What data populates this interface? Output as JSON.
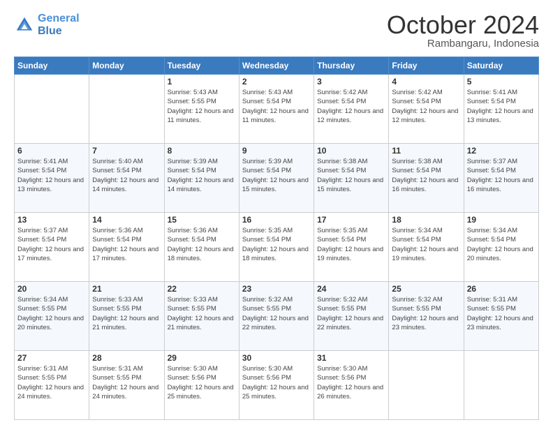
{
  "logo": {
    "line1": "General",
    "line2": "Blue"
  },
  "header": {
    "month": "October 2024",
    "location": "Rambangaru, Indonesia"
  },
  "weekdays": [
    "Sunday",
    "Monday",
    "Tuesday",
    "Wednesday",
    "Thursday",
    "Friday",
    "Saturday"
  ],
  "weeks": [
    [
      {
        "day": "",
        "sunrise": "",
        "sunset": "",
        "daylight": ""
      },
      {
        "day": "",
        "sunrise": "",
        "sunset": "",
        "daylight": ""
      },
      {
        "day": "1",
        "sunrise": "Sunrise: 5:43 AM",
        "sunset": "Sunset: 5:55 PM",
        "daylight": "Daylight: 12 hours and 11 minutes."
      },
      {
        "day": "2",
        "sunrise": "Sunrise: 5:43 AM",
        "sunset": "Sunset: 5:54 PM",
        "daylight": "Daylight: 12 hours and 11 minutes."
      },
      {
        "day": "3",
        "sunrise": "Sunrise: 5:42 AM",
        "sunset": "Sunset: 5:54 PM",
        "daylight": "Daylight: 12 hours and 12 minutes."
      },
      {
        "day": "4",
        "sunrise": "Sunrise: 5:42 AM",
        "sunset": "Sunset: 5:54 PM",
        "daylight": "Daylight: 12 hours and 12 minutes."
      },
      {
        "day": "5",
        "sunrise": "Sunrise: 5:41 AM",
        "sunset": "Sunset: 5:54 PM",
        "daylight": "Daylight: 12 hours and 13 minutes."
      }
    ],
    [
      {
        "day": "6",
        "sunrise": "Sunrise: 5:41 AM",
        "sunset": "Sunset: 5:54 PM",
        "daylight": "Daylight: 12 hours and 13 minutes."
      },
      {
        "day": "7",
        "sunrise": "Sunrise: 5:40 AM",
        "sunset": "Sunset: 5:54 PM",
        "daylight": "Daylight: 12 hours and 14 minutes."
      },
      {
        "day": "8",
        "sunrise": "Sunrise: 5:39 AM",
        "sunset": "Sunset: 5:54 PM",
        "daylight": "Daylight: 12 hours and 14 minutes."
      },
      {
        "day": "9",
        "sunrise": "Sunrise: 5:39 AM",
        "sunset": "Sunset: 5:54 PM",
        "daylight": "Daylight: 12 hours and 15 minutes."
      },
      {
        "day": "10",
        "sunrise": "Sunrise: 5:38 AM",
        "sunset": "Sunset: 5:54 PM",
        "daylight": "Daylight: 12 hours and 15 minutes."
      },
      {
        "day": "11",
        "sunrise": "Sunrise: 5:38 AM",
        "sunset": "Sunset: 5:54 PM",
        "daylight": "Daylight: 12 hours and 16 minutes."
      },
      {
        "day": "12",
        "sunrise": "Sunrise: 5:37 AM",
        "sunset": "Sunset: 5:54 PM",
        "daylight": "Daylight: 12 hours and 16 minutes."
      }
    ],
    [
      {
        "day": "13",
        "sunrise": "Sunrise: 5:37 AM",
        "sunset": "Sunset: 5:54 PM",
        "daylight": "Daylight: 12 hours and 17 minutes."
      },
      {
        "day": "14",
        "sunrise": "Sunrise: 5:36 AM",
        "sunset": "Sunset: 5:54 PM",
        "daylight": "Daylight: 12 hours and 17 minutes."
      },
      {
        "day": "15",
        "sunrise": "Sunrise: 5:36 AM",
        "sunset": "Sunset: 5:54 PM",
        "daylight": "Daylight: 12 hours and 18 minutes."
      },
      {
        "day": "16",
        "sunrise": "Sunrise: 5:35 AM",
        "sunset": "Sunset: 5:54 PM",
        "daylight": "Daylight: 12 hours and 18 minutes."
      },
      {
        "day": "17",
        "sunrise": "Sunrise: 5:35 AM",
        "sunset": "Sunset: 5:54 PM",
        "daylight": "Daylight: 12 hours and 19 minutes."
      },
      {
        "day": "18",
        "sunrise": "Sunrise: 5:34 AM",
        "sunset": "Sunset: 5:54 PM",
        "daylight": "Daylight: 12 hours and 19 minutes."
      },
      {
        "day": "19",
        "sunrise": "Sunrise: 5:34 AM",
        "sunset": "Sunset: 5:54 PM",
        "daylight": "Daylight: 12 hours and 20 minutes."
      }
    ],
    [
      {
        "day": "20",
        "sunrise": "Sunrise: 5:34 AM",
        "sunset": "Sunset: 5:55 PM",
        "daylight": "Daylight: 12 hours and 20 minutes."
      },
      {
        "day": "21",
        "sunrise": "Sunrise: 5:33 AM",
        "sunset": "Sunset: 5:55 PM",
        "daylight": "Daylight: 12 hours and 21 minutes."
      },
      {
        "day": "22",
        "sunrise": "Sunrise: 5:33 AM",
        "sunset": "Sunset: 5:55 PM",
        "daylight": "Daylight: 12 hours and 21 minutes."
      },
      {
        "day": "23",
        "sunrise": "Sunrise: 5:32 AM",
        "sunset": "Sunset: 5:55 PM",
        "daylight": "Daylight: 12 hours and 22 minutes."
      },
      {
        "day": "24",
        "sunrise": "Sunrise: 5:32 AM",
        "sunset": "Sunset: 5:55 PM",
        "daylight": "Daylight: 12 hours and 22 minutes."
      },
      {
        "day": "25",
        "sunrise": "Sunrise: 5:32 AM",
        "sunset": "Sunset: 5:55 PM",
        "daylight": "Daylight: 12 hours and 23 minutes."
      },
      {
        "day": "26",
        "sunrise": "Sunrise: 5:31 AM",
        "sunset": "Sunset: 5:55 PM",
        "daylight": "Daylight: 12 hours and 23 minutes."
      }
    ],
    [
      {
        "day": "27",
        "sunrise": "Sunrise: 5:31 AM",
        "sunset": "Sunset: 5:55 PM",
        "daylight": "Daylight: 12 hours and 24 minutes."
      },
      {
        "day": "28",
        "sunrise": "Sunrise: 5:31 AM",
        "sunset": "Sunset: 5:55 PM",
        "daylight": "Daylight: 12 hours and 24 minutes."
      },
      {
        "day": "29",
        "sunrise": "Sunrise: 5:30 AM",
        "sunset": "Sunset: 5:56 PM",
        "daylight": "Daylight: 12 hours and 25 minutes."
      },
      {
        "day": "30",
        "sunrise": "Sunrise: 5:30 AM",
        "sunset": "Sunset: 5:56 PM",
        "daylight": "Daylight: 12 hours and 25 minutes."
      },
      {
        "day": "31",
        "sunrise": "Sunrise: 5:30 AM",
        "sunset": "Sunset: 5:56 PM",
        "daylight": "Daylight: 12 hours and 26 minutes."
      },
      {
        "day": "",
        "sunrise": "",
        "sunset": "",
        "daylight": ""
      },
      {
        "day": "",
        "sunrise": "",
        "sunset": "",
        "daylight": ""
      }
    ]
  ]
}
